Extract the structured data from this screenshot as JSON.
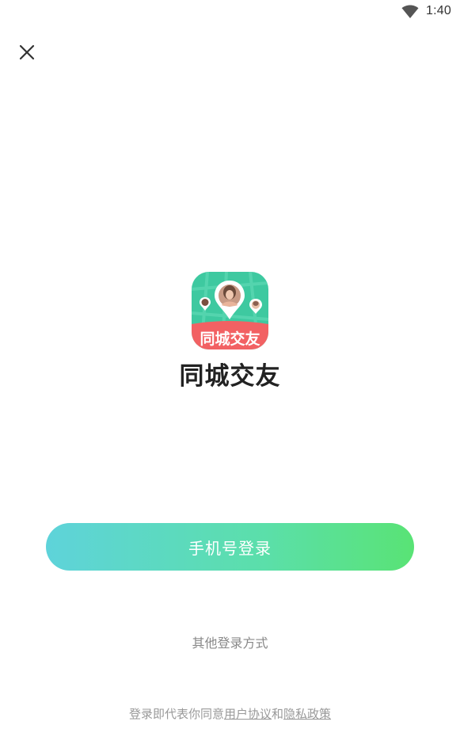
{
  "status_bar": {
    "time": "1:40",
    "wifi_icon": "wifi-icon"
  },
  "header": {
    "close_icon": "close-icon"
  },
  "logo": {
    "banner_text": "同城交友",
    "colors": {
      "background": "#3ec9a0",
      "banner": "#f26163",
      "pin": "#ffffff"
    }
  },
  "app_name": "同城交友",
  "login": {
    "phone_button_label": "手机号登录",
    "other_methods_label": "其他登录方式",
    "gradient": [
      "#5ed3da",
      "#59e375"
    ]
  },
  "agreement": {
    "prefix": "登录即代表你同意",
    "user_agreement": "用户协议",
    "conjunction": "和",
    "privacy_policy": "隐私政策"
  }
}
